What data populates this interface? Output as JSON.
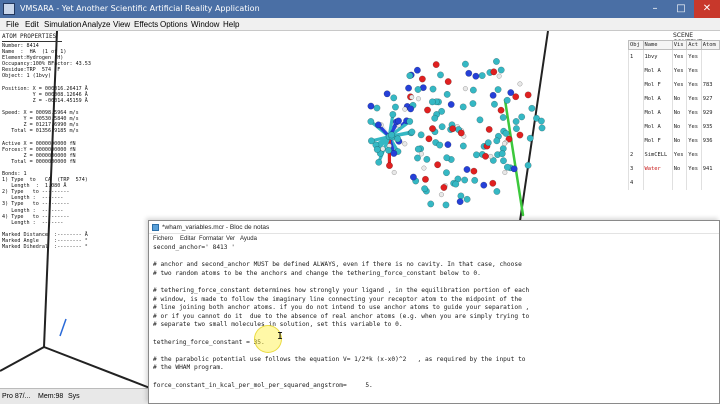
{
  "app": {
    "title": "VMSARA - Yet Another Scientific Artificial Reality Application",
    "menu": [
      "File",
      "Edit",
      "Simulation",
      "Analyze",
      "View",
      "Effects",
      "Options",
      "Window",
      "Help"
    ]
  },
  "atom_properties": {
    "title": "ATOM PROPERTIES",
    "lines": [
      "Number: 8414",
      "Name  :  HA  (1 of 1)",
      "Element:Hydrogen (H)",
      "Occupancy:100% BFactor: 43.53",
      "Residue:TRP  574  F",
      "Object: 1 (1bvy)",
      "",
      "Position: X = 000016.26417 Å",
      "          Y = 000008.12646 Å",
      "          Z = -00014.45159 Å",
      "",
      "Speed: X = 00098.5964 m/s",
      "       Y = 00530.5840 m/s",
      "       Z = 01217.6990 m/s",
      "   Total = 01356.9185 m/s",
      "",
      "Active X = 0000000000 fN",
      "Forces:Y = 0000000000 fN",
      "       Z = 0000000000 fN",
      "   Total = 0000000000 fN",
      "",
      "Bonds: 1",
      "1) Type  to   CA  (TRP  574)",
      "   Length  :  1.080 Å",
      "2) Type   to ---------",
      "   Length :  -------",
      "3) Type   to ---------",
      "   Length :  -------",
      "4) Type   to ---------",
      "   Length :  -------",
      "",
      "Marked Distance  :-------- Å",
      "Marked Angle     :-------- °",
      "Marked Dihedral  :-------- °"
    ]
  },
  "scene_objects": {
    "title": "SCENE CONTENT",
    "columns": [
      "Obj",
      "Name",
      "Vis",
      "Act",
      "Atom"
    ],
    "rows": [
      {
        "obj": "1",
        "name": "1bvy",
        "vis": "Yes",
        "act": "Yes",
        "atom": "",
        "red": false
      },
      {
        "obj": "",
        "name": "Mol A",
        "vis": "Yes",
        "act": "Yes",
        "atom": "",
        "red": false
      },
      {
        "obj": "",
        "name": "Mol F",
        "vis": "Yes",
        "act": "Yes",
        "atom": "783",
        "red": false
      },
      {
        "obj": "",
        "name": "Mol A",
        "vis": "No",
        "act": "Yes",
        "atom": "927",
        "red": false
      },
      {
        "obj": "",
        "name": "Mol A",
        "vis": "No",
        "act": "Yes",
        "atom": "929",
        "red": false
      },
      {
        "obj": "",
        "name": "Mol A",
        "vis": "No",
        "act": "Yes",
        "atom": "935",
        "red": false
      },
      {
        "obj": "",
        "name": "Mol F",
        "vis": "No",
        "act": "Yes",
        "atom": "936",
        "red": false
      },
      {
        "obj": "2",
        "name": "SimCELL",
        "vis": "Yes",
        "act": "Yes",
        "atom": "",
        "red": false
      },
      {
        "obj": "3",
        "name": "Water",
        "vis": "No",
        "act": "Yes",
        "atom": "941",
        "red": true
      },
      {
        "obj": "4",
        "name": "",
        "vis": "",
        "act": "",
        "atom": "",
        "red": false
      }
    ]
  },
  "status": {
    "left": "Pro 87/...",
    "mem": "Mem:98",
    "sys": "Sys"
  },
  "notepad": {
    "title": "*wham_variables.mcr - Bloc de notas",
    "menu": [
      "Fichero",
      "Editar",
      "Formatar",
      "Ver",
      "Ayuda"
    ],
    "lines": [
      "second_anchor=' 8413 '",
      "",
      "# anchor and second_anchor MUST be defined ALWAYS, even if there is no cavity. In that case, choose",
      "# two random atoms to be the anchors and change the tethering_force_constant below to 0.",
      "",
      "# tethering_force_constant determines how strongly your ligand , in the equilibration portion of each",
      "# window, is made to follow the imaginary line connecting your receptor atom to the midpoint of the",
      "# line joining both anchor atoms. if you do not intend to use anchor atoms to guide your separation ,",
      "# or if you cannot do it  due to the absence of real anchor atoms (e.g. when you are simply trying to",
      "# separate two small molecules in solution, set this variable to 0.",
      "",
      "tethering_force_constant = 35.",
      "",
      "# the parabolic potential use follows the equation V= 1/2*k (x-x0)^2   , as required by the input to",
      "# the WHAM program.",
      "",
      "force_constant_in_kcal_per_mol_per_squared_angstrom=     5."
    ]
  },
  "colors": {
    "titlebar": "#4a6fa5",
    "carbon": "#35b8c4",
    "oxygen": "#e02020",
    "nitrogen": "#2540d8",
    "hydrogen": "#e8e8e8",
    "bond_green": "#3cc83c",
    "highlight": "#fff03c"
  },
  "icons": {
    "app": "yasara-app-icon",
    "notepad": "notepad-icon",
    "cursor": "text-cursor-icon"
  }
}
